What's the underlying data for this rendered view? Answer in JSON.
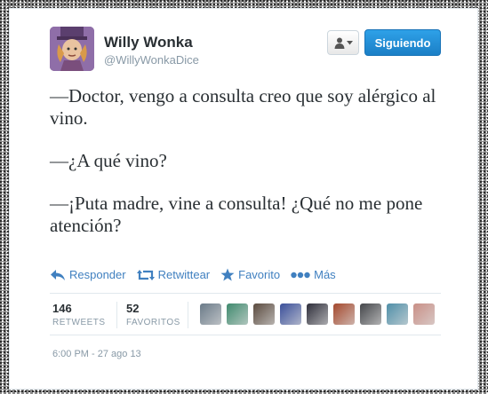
{
  "tweet": {
    "name": "Willy Wonka",
    "handle": "@WillyWonkaDice",
    "follow_label": "Siguiendo",
    "paragraphs": [
      "—Doctor, vengo a consulta creo que soy alérgico al vino.",
      "—¿A qué vino?",
      "—¡Puta madre, vine a consulta! ¿Qué no me pone atención?"
    ],
    "actions": {
      "reply": "Responder",
      "retweet": "Retwittear",
      "favorite": "Favorito",
      "more": "Más"
    },
    "stats": {
      "retweets_count": "146",
      "retweets_label": "RETWEETS",
      "favorites_count": "52",
      "favorites_label": "FAVORITOS"
    },
    "timestamp": "6:00 PM - 27 ago 13"
  },
  "icons": {
    "avatar": "willy-wonka-avatar",
    "user_menu": "user-icon",
    "reply": "reply-arrow-icon",
    "retweet": "retweet-icon",
    "favorite": "star-icon",
    "more": "dots-icon"
  },
  "colors": {
    "follow_button": "#2b9de6",
    "action_link": "#4080c0"
  },
  "favoriters": [
    {
      "color": "#6a7a88"
    },
    {
      "color": "#3f8a6e"
    },
    {
      "color": "#5a4a3e"
    },
    {
      "color": "#3a4f9a"
    },
    {
      "color": "#2e2e3a"
    },
    {
      "color": "#a4482c"
    },
    {
      "color": "#44464a"
    },
    {
      "color": "#4f8fa8"
    },
    {
      "color": "#c98f86"
    }
  ]
}
